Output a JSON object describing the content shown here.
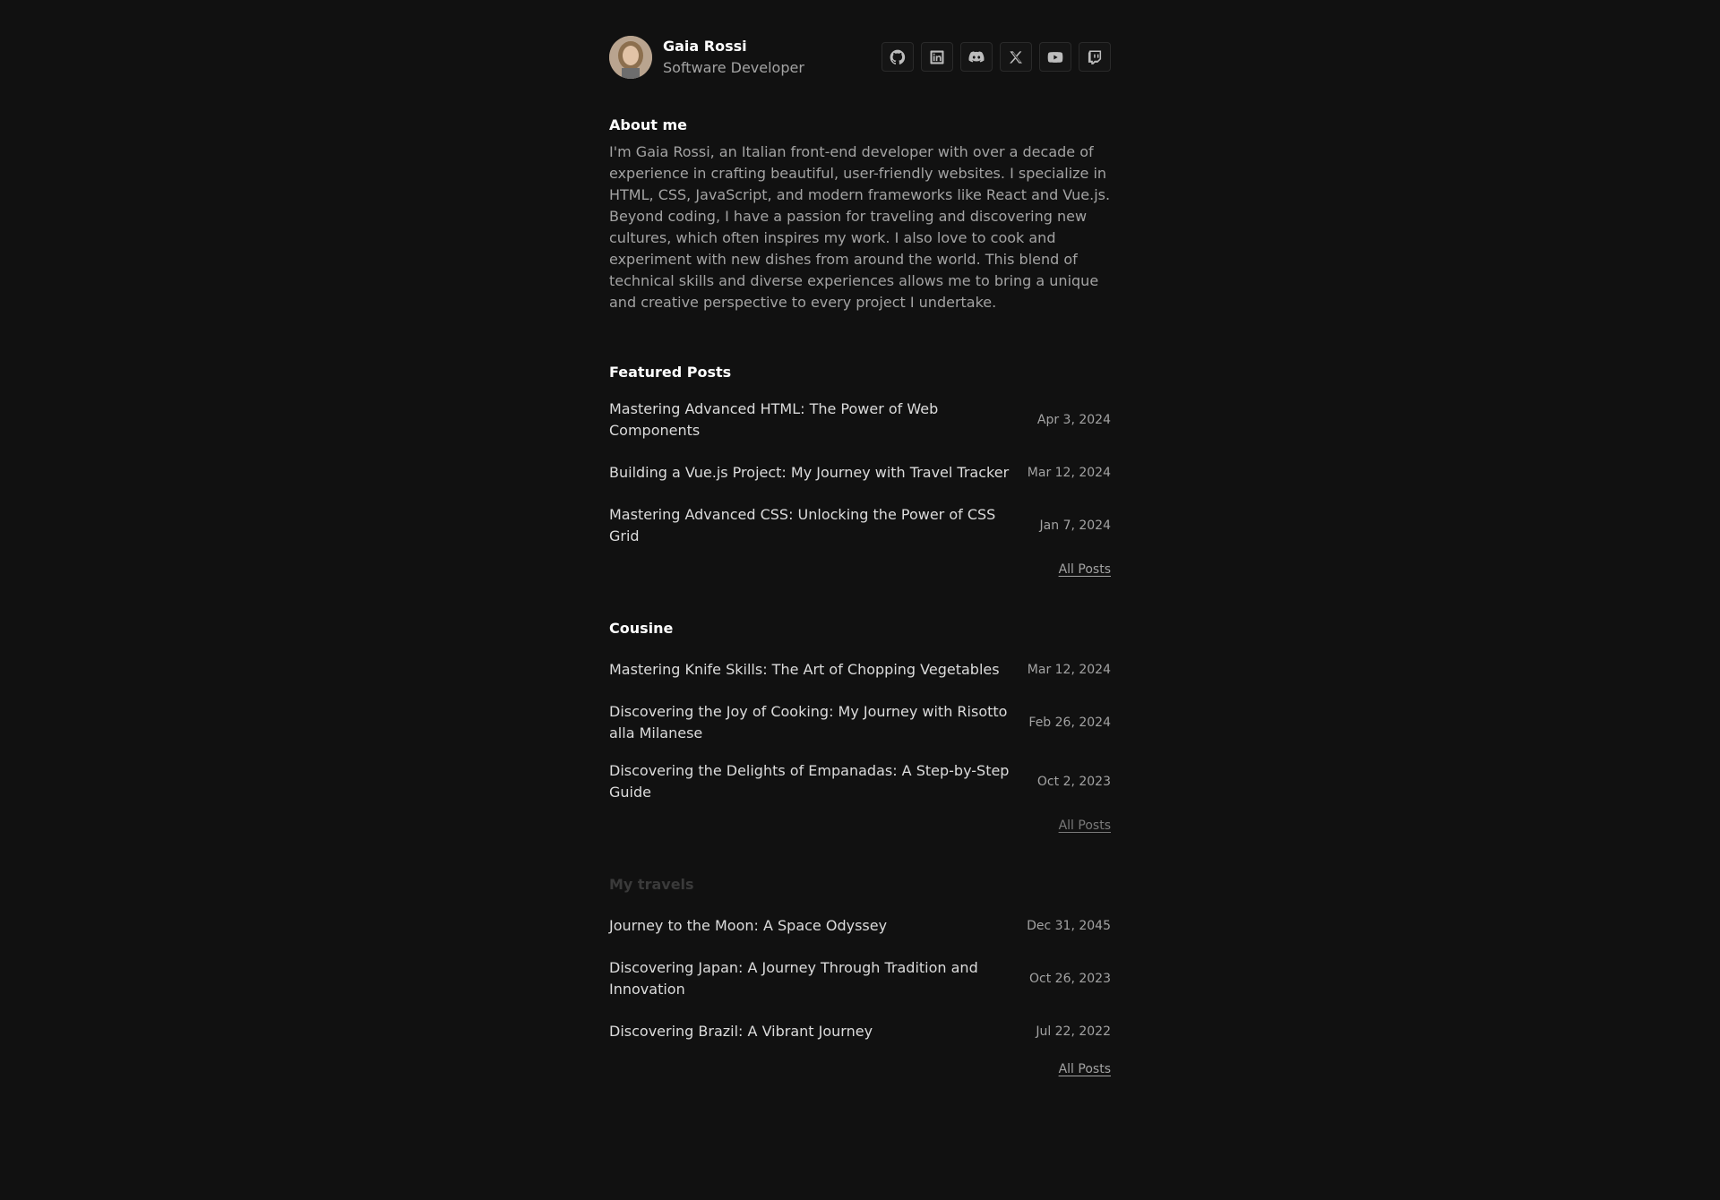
{
  "profile": {
    "name": "Gaia Rossi",
    "role": "Software Developer"
  },
  "socials": [
    {
      "icon": "github-icon"
    },
    {
      "icon": "linkedin-icon"
    },
    {
      "icon": "discord-icon"
    },
    {
      "icon": "x-icon"
    },
    {
      "icon": "youtube-icon"
    },
    {
      "icon": "twitch-icon"
    }
  ],
  "about": {
    "title": "About me",
    "text": "I'm Gaia Rossi, an Italian front-end developer with over a decade of experience in crafting beautiful, user-friendly websites. I specialize in HTML, CSS, JavaScript, and modern frameworks like React and Vue.js. Beyond coding, I have a passion for traveling and discovering new cultures, which often inspires my work. I also love to cook and experiment with new dishes from around the world. This blend of technical skills and diverse experiences allows me to bring a unique and creative perspective to every project I undertake."
  },
  "featured": {
    "title": "Featured Posts",
    "all_label": "All Posts",
    "posts": [
      {
        "title": "Mastering Advanced HTML: The Power of Web Components",
        "date": "Apr 3, 2024"
      },
      {
        "title": "Building a Vue.js Project: My Journey with Travel Tracker",
        "date": "Mar 12, 2024"
      },
      {
        "title": "Mastering Advanced CSS: Unlocking the Power of CSS Grid",
        "date": "Jan 7, 2024"
      }
    ]
  },
  "cousine": {
    "title": "Cousine",
    "all_label": "All Posts",
    "posts": [
      {
        "title": "Mastering Knife Skills: The Art of Chopping Vegetables",
        "date": "Mar 12, 2024"
      },
      {
        "title": "Discovering the Joy of Cooking: My Journey with Risotto alla Milanese",
        "date": "Feb 26, 2024"
      },
      {
        "title": "Discovering the Delights of Empanadas: A Step-by-Step Guide",
        "date": "Oct 2, 2023"
      }
    ]
  },
  "travels": {
    "title": "My travels",
    "all_label": "All Posts",
    "posts": [
      {
        "title": "Journey to the Moon: A Space Odyssey",
        "date": "Dec 31, 2045"
      },
      {
        "title": "Discovering Japan: A Journey Through Tradition and Innovation",
        "date": "Oct 26, 2023"
      },
      {
        "title": "Discovering Brazil: A Vibrant Journey",
        "date": "Jul 22, 2022"
      }
    ]
  }
}
